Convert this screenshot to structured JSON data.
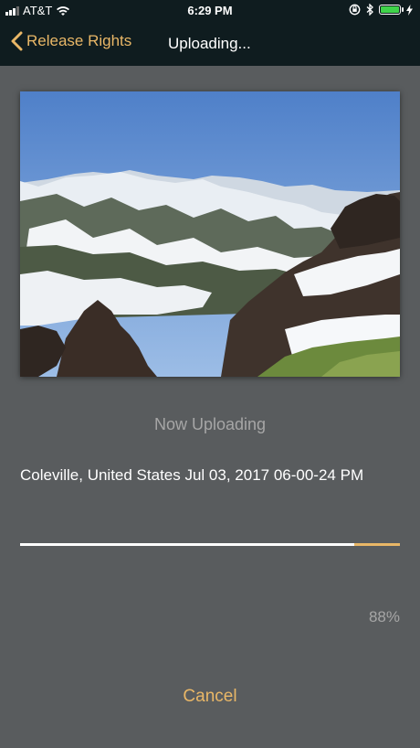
{
  "status_bar": {
    "carrier": "AT&T",
    "time": "6:29 PM",
    "wifi_icon": "wifi-icon",
    "battery_color": "#3fd34a"
  },
  "nav": {
    "back_label": "Release Rights",
    "title": "Uploading...",
    "accent_color": "#e9b767"
  },
  "main": {
    "photo_alt": "Mountain landscape photo",
    "status_label": "Now Uploading",
    "file_name": "Coleville, United States Jul 03, 2017 06-00-24 PM",
    "progress_fraction": 0.88,
    "progress_label": "88%",
    "cancel_label": "Cancel"
  }
}
